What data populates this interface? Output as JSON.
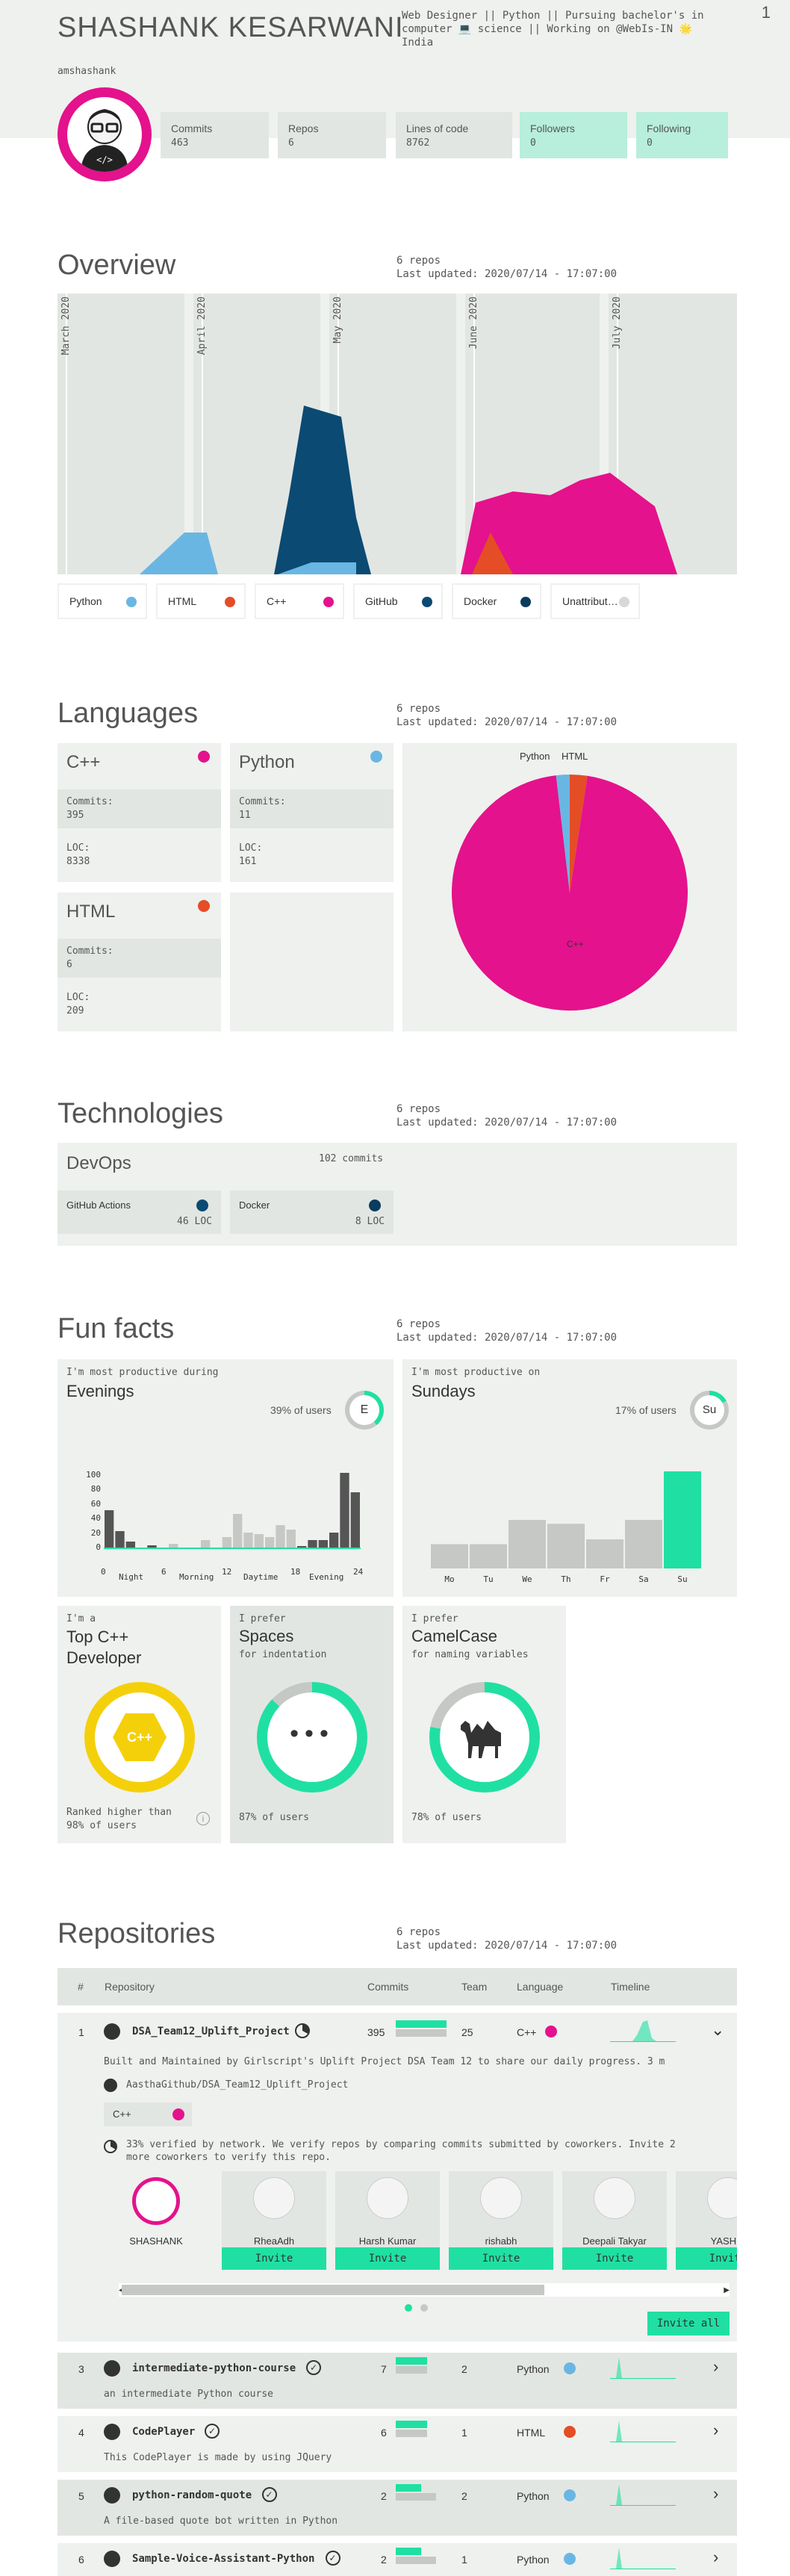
{
  "header": {
    "page_number": "1",
    "name": "SHASHANK KESARWANI",
    "bio": "Web Designer || Python || Pursuing bachelor's in computer 💻 science || Working on @WebIs-IN 🌟 India",
    "login": "amshashank",
    "stats": [
      {
        "label": "Commits",
        "value": "463"
      },
      {
        "label": "Repos",
        "value": "6"
      },
      {
        "label": "Lines of code",
        "value": "8762"
      },
      {
        "label": "Followers",
        "value": "0"
      },
      {
        "label": "Following",
        "value": "0"
      }
    ]
  },
  "overview": {
    "title": "Overview",
    "repos": "6 repos",
    "updated": "Last updated: 2020/07/14 - 17:07:00",
    "months": [
      "March 2020",
      "April 2020",
      "May 2020",
      "June 2020",
      "July 2020"
    ],
    "legend": [
      {
        "label": "Python",
        "color": "#6ab6e3"
      },
      {
        "label": "HTML",
        "color": "#e44d26"
      },
      {
        "label": "C++",
        "color": "#e4128c"
      },
      {
        "label": "GitHub",
        "color": "#0b4a73"
      },
      {
        "label": "Docker",
        "color": "#0b3c5d"
      },
      {
        "label": "Unattribut…",
        "color": "#d6d9d6"
      }
    ]
  },
  "languages": {
    "title": "Languages",
    "repos": "6 repos",
    "updated": "Last updated: 2020/07/14 - 17:07:00",
    "commits_label": "Commits:",
    "loc_label": "LOC:",
    "items": [
      {
        "name": "C++",
        "commits": "395",
        "loc": "8338",
        "color": "#e4128c"
      },
      {
        "name": "Python",
        "commits": "11",
        "loc": "161",
        "color": "#6ab6e3"
      },
      {
        "name": "HTML",
        "commits": "6",
        "loc": "209",
        "color": "#e44d26"
      }
    ],
    "pie_labels": {
      "python": "Python",
      "html": "HTML",
      "cpp": "C++"
    }
  },
  "chart_data": {
    "type": "pie",
    "categories": [
      "C++",
      "Python",
      "HTML"
    ],
    "values": [
      8338,
      161,
      209
    ]
  },
  "technologies": {
    "title": "Technologies",
    "repos": "6 repos",
    "updated": "Last updated: 2020/07/14 - 17:07:00",
    "group": "DevOps",
    "group_commits": "102 commits",
    "items": [
      {
        "name": "GitHub Actions",
        "loc": "46 LOC",
        "color": "#0b4a73"
      },
      {
        "name": "Docker",
        "loc": "8 LOC",
        "color": "#0b3c5d"
      }
    ]
  },
  "funfacts": {
    "title": "Fun facts",
    "repos": "6 repos",
    "updated": "Last updated: 2020/07/14 - 17:07:00",
    "productive_during_label": "I'm most productive during",
    "productive_during": "Evenings",
    "during_pct": "39% of users",
    "during_badge": "E",
    "hour_ticks": [
      "100",
      "80",
      "60",
      "40",
      "20",
      "0"
    ],
    "hour_axis": [
      "0",
      "Night",
      "6",
      "Morning",
      "12",
      "Daytime",
      "18",
      "Evening",
      "24"
    ],
    "productive_on_label": "I'm most productive on",
    "productive_on": "Sundays",
    "on_pct": "17% of users",
    "on_badge": "Su",
    "days": [
      "Mo",
      "Tu",
      "We",
      "Th",
      "Fr",
      "Sa",
      "Su"
    ],
    "days_values": [
      0.25,
      0.25,
      0.5,
      0.46,
      0.3,
      0.5,
      1.0
    ],
    "top_label": "I'm a",
    "top_title": "Top C++ Developer",
    "top_badge": "C++",
    "top_rank": "Ranked higher than 98% of users",
    "spaces_label": "I prefer",
    "spaces_title": "Spaces",
    "spaces_sub": "for indentation",
    "spaces_pct": "87% of users",
    "camel_label": "I prefer",
    "camel_title": "CamelCase",
    "camel_sub": "for naming variables",
    "camel_pct": "78% of users"
  },
  "repositories": {
    "title": "Repositories",
    "repos": "6 repos",
    "updated": "Last updated: 2020/07/14 - 17:07:00",
    "headers": [
      "#",
      "Repository",
      "Commits",
      "Team",
      "Language",
      "Timeline"
    ],
    "expanded": {
      "index": "1",
      "name": "DSA_Team12_Uplift_Project",
      "commits": "395",
      "team": "25",
      "language": "C++",
      "language_color": "#e4128c",
      "description": "Built and Maintained by Girlscript's Uplift Project DSA Team 12  to share our daily progress. 3 m",
      "fork_source": "AasthaGithub/DSA_Team12_Uplift_Project",
      "lang_chip": "C++",
      "verified": "33% verified by network. We verify repos by comparing commits submitted by coworkers. Invite 2 more coworkers to verify this repo.",
      "owner": "SHASHANK",
      "coworkers": [
        "RheaAdh",
        "Harsh Kumar",
        "rishabh",
        "Deepali Takyar",
        "YASHIK"
      ],
      "invite_label": "Invite",
      "invite_all": "Invite all"
    },
    "rows": [
      {
        "index": "3",
        "name": "intermediate-python-course",
        "commits": "7",
        "team": "2",
        "language": "Python",
        "color": "#6ab6e3",
        "desc": "an intermediate Python course"
      },
      {
        "index": "4",
        "name": "CodePlayer",
        "commits": "6",
        "team": "1",
        "language": "HTML",
        "color": "#e44d26",
        "desc": "This CodePlayer is made by  using JQuery"
      },
      {
        "index": "5",
        "name": "python-random-quote",
        "commits": "2",
        "team": "2",
        "language": "Python",
        "color": "#6ab6e3",
        "desc": "A file-based quote bot written in Python"
      },
      {
        "index": "6",
        "name": "Sample-Voice-Assistant-Python",
        "commits": "2",
        "team": "1",
        "language": "Python",
        "color": "#6ab6e3",
        "desc": ""
      }
    ]
  }
}
